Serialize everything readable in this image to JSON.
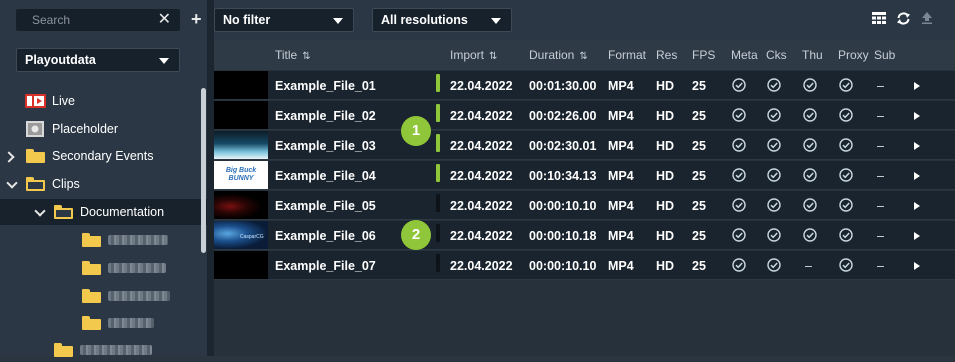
{
  "toolbar": {
    "search_placeholder": "Search",
    "filter_label": "No filter",
    "resolution_label": "All resolutions"
  },
  "sidebar": {
    "source_label": "Playoutdata",
    "items": [
      {
        "label": "Live"
      },
      {
        "label": "Placeholder"
      },
      {
        "label": "Secondary Events"
      },
      {
        "label": "Clips"
      },
      {
        "label": "Documentation"
      }
    ]
  },
  "table": {
    "columns": [
      "Title",
      "Import",
      "Duration",
      "Format",
      "Res",
      "FPS",
      "Meta",
      "Cks",
      "Thu",
      "Proxy",
      "Sub"
    ],
    "rows": [
      {
        "title": "Example_File_01",
        "import": "22.04.2022",
        "duration": "00:01:30.00",
        "format": "MP4",
        "res": "HD",
        "fps": "25",
        "meta": "check",
        "cks": "check",
        "thu": "check",
        "proxy": "check",
        "sub": "–",
        "status": "green"
      },
      {
        "title": "Example_File_02",
        "import": "22.04.2022",
        "duration": "00:02:26.00",
        "format": "MP4",
        "res": "HD",
        "fps": "25",
        "meta": "check",
        "cks": "check",
        "thu": "check",
        "proxy": "check",
        "sub": "–",
        "status": "green"
      },
      {
        "title": "Example_File_03",
        "import": "22.04.2022",
        "duration": "00:02:30.01",
        "format": "MP4",
        "res": "HD",
        "fps": "25",
        "meta": "check",
        "cks": "check",
        "thu": "check",
        "proxy": "check",
        "sub": "–",
        "status": "green"
      },
      {
        "title": "Example_File_04",
        "import": "22.04.2022",
        "duration": "00:10:34.13",
        "format": "MP4",
        "res": "HD",
        "fps": "25",
        "meta": "check",
        "cks": "check",
        "thu": "check",
        "proxy": "check",
        "sub": "–",
        "status": "green"
      },
      {
        "title": "Example_File_05",
        "import": "22.04.2022",
        "duration": "00:00:10.10",
        "format": "MP4",
        "res": "HD",
        "fps": "25",
        "meta": "check",
        "cks": "check",
        "thu": "check",
        "proxy": "check",
        "sub": "–",
        "status": "dark"
      },
      {
        "title": "Example_File_06",
        "import": "22.04.2022",
        "duration": "00:00:10.18",
        "format": "MP4",
        "res": "HD",
        "fps": "25",
        "meta": "check",
        "cks": "check",
        "thu": "check",
        "proxy": "check",
        "sub": "–",
        "status": "dark"
      },
      {
        "title": "Example_File_07",
        "import": "22.04.2022",
        "duration": "00:00:10.10",
        "format": "MP4",
        "res": "HD",
        "fps": "25",
        "meta": "check",
        "cks": "check",
        "thu": "–",
        "proxy": "check",
        "sub": "–",
        "status": "dark"
      }
    ]
  },
  "thumbnails": {
    "file_04_text": "Big Buck BUNNY",
    "file_06_text": "CasparCG"
  },
  "badges": [
    "1",
    "2"
  ],
  "colors": {
    "accent_green": "#8fc63a",
    "check_color": "#c9d8e0",
    "folder": "#f2c94c",
    "status_dark": "#0d1318"
  },
  "icons": {
    "toolbar": [
      "grid-view-icon",
      "refresh-icon",
      "upload-icon"
    ],
    "live": "live-icon",
    "placeholder": "placeholder-icon"
  }
}
